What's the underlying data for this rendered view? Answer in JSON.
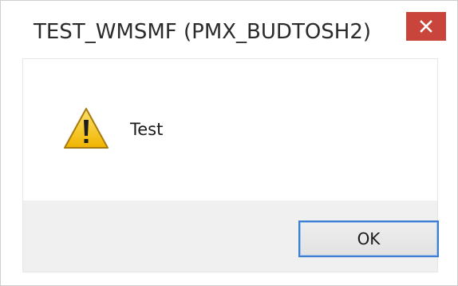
{
  "window": {
    "title": "TEST_WMSMF (PMX_BUDTOSH2)",
    "close_icon": "close-icon"
  },
  "dialog": {
    "icon": "warning-icon",
    "message": "Test",
    "ok_label": "OK"
  },
  "colors": {
    "close_button": "#c9453c",
    "button_focus_border": "#3c7fd0",
    "warning_yellow": "#f5c21b",
    "footer_background": "#f0f0f0"
  }
}
